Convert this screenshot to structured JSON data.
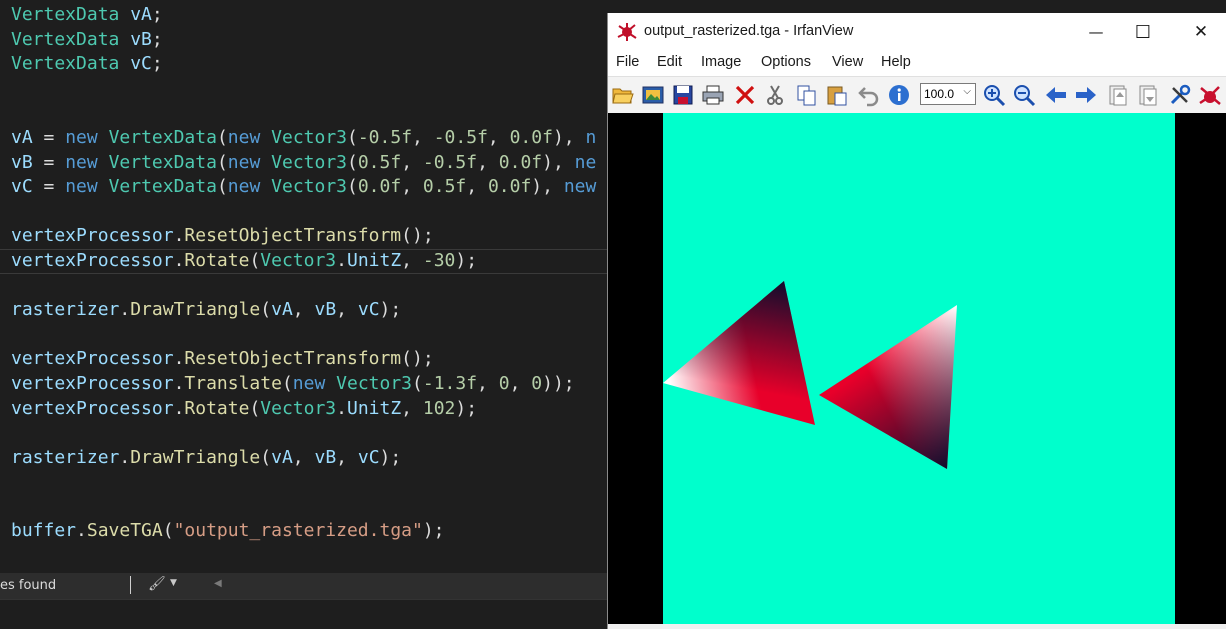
{
  "editor": {
    "lines": [
      [
        {
          "c": "t-type",
          "t": "VertexData"
        },
        {
          "c": "t-var",
          "t": " vA"
        },
        {
          "c": "t-pun",
          "t": ";"
        }
      ],
      [
        {
          "c": "t-type",
          "t": "VertexData"
        },
        {
          "c": "t-var",
          "t": " vB"
        },
        {
          "c": "t-pun",
          "t": ";"
        }
      ],
      [
        {
          "c": "t-type",
          "t": "VertexData"
        },
        {
          "c": "t-var",
          "t": " vC"
        },
        {
          "c": "t-pun",
          "t": ";"
        }
      ],
      [],
      [],
      [
        {
          "c": "t-var",
          "t": "vA"
        },
        {
          "c": "t-pun",
          "t": " = "
        },
        {
          "c": "t-kw",
          "t": "new"
        },
        {
          "c": "t-pun",
          "t": " "
        },
        {
          "c": "t-type",
          "t": "VertexData"
        },
        {
          "c": "t-pun",
          "t": "("
        },
        {
          "c": "t-kw",
          "t": "new"
        },
        {
          "c": "t-pun",
          "t": " "
        },
        {
          "c": "t-type",
          "t": "Vector3"
        },
        {
          "c": "t-pun",
          "t": "("
        },
        {
          "c": "t-num",
          "t": "-0.5f"
        },
        {
          "c": "t-pun",
          "t": ", "
        },
        {
          "c": "t-num",
          "t": "-0.5f"
        },
        {
          "c": "t-pun",
          "t": ", "
        },
        {
          "c": "t-num",
          "t": "0.0f"
        },
        {
          "c": "t-pun",
          "t": "), "
        },
        {
          "c": "t-kw",
          "t": "n"
        }
      ],
      [
        {
          "c": "t-var",
          "t": "vB"
        },
        {
          "c": "t-pun",
          "t": " = "
        },
        {
          "c": "t-kw",
          "t": "new"
        },
        {
          "c": "t-pun",
          "t": " "
        },
        {
          "c": "t-type",
          "t": "VertexData"
        },
        {
          "c": "t-pun",
          "t": "("
        },
        {
          "c": "t-kw",
          "t": "new"
        },
        {
          "c": "t-pun",
          "t": " "
        },
        {
          "c": "t-type",
          "t": "Vector3"
        },
        {
          "c": "t-pun",
          "t": "("
        },
        {
          "c": "t-num",
          "t": "0.5f"
        },
        {
          "c": "t-pun",
          "t": ", "
        },
        {
          "c": "t-num",
          "t": "-0.5f"
        },
        {
          "c": "t-pun",
          "t": ", "
        },
        {
          "c": "t-num",
          "t": "0.0f"
        },
        {
          "c": "t-pun",
          "t": "), "
        },
        {
          "c": "t-kw",
          "t": "ne"
        }
      ],
      [
        {
          "c": "t-var",
          "t": "vC"
        },
        {
          "c": "t-pun",
          "t": " = "
        },
        {
          "c": "t-kw",
          "t": "new"
        },
        {
          "c": "t-pun",
          "t": " "
        },
        {
          "c": "t-type",
          "t": "VertexData"
        },
        {
          "c": "t-pun",
          "t": "("
        },
        {
          "c": "t-kw",
          "t": "new"
        },
        {
          "c": "t-pun",
          "t": " "
        },
        {
          "c": "t-type",
          "t": "Vector3"
        },
        {
          "c": "t-pun",
          "t": "("
        },
        {
          "c": "t-num",
          "t": "0.0f"
        },
        {
          "c": "t-pun",
          "t": ", "
        },
        {
          "c": "t-num",
          "t": "0.5f"
        },
        {
          "c": "t-pun",
          "t": ", "
        },
        {
          "c": "t-num",
          "t": "0.0f"
        },
        {
          "c": "t-pun",
          "t": "), "
        },
        {
          "c": "t-kw",
          "t": "new"
        }
      ],
      [],
      [
        {
          "c": "t-var",
          "t": "vertexProcessor"
        },
        {
          "c": "t-pun",
          "t": "."
        },
        {
          "c": "t-fn",
          "t": "ResetObjectTransform"
        },
        {
          "c": "t-pun",
          "t": "();"
        }
      ],
      [
        {
          "c": "t-var",
          "t": "vertexProcessor"
        },
        {
          "c": "t-pun",
          "t": "."
        },
        {
          "c": "t-fn",
          "t": "Rotate"
        },
        {
          "c": "t-pun",
          "t": "("
        },
        {
          "c": "t-type",
          "t": "Vector3"
        },
        {
          "c": "t-pun",
          "t": "."
        },
        {
          "c": "t-var",
          "t": "UnitZ"
        },
        {
          "c": "t-pun",
          "t": ", "
        },
        {
          "c": "t-num",
          "t": "-30"
        },
        {
          "c": "t-pun",
          "t": ");"
        }
      ],
      [],
      [
        {
          "c": "t-var",
          "t": "rasterizer"
        },
        {
          "c": "t-pun",
          "t": "."
        },
        {
          "c": "t-fn",
          "t": "DrawTriangle"
        },
        {
          "c": "t-pun",
          "t": "("
        },
        {
          "c": "t-var",
          "t": "vA"
        },
        {
          "c": "t-pun",
          "t": ", "
        },
        {
          "c": "t-var",
          "t": "vB"
        },
        {
          "c": "t-pun",
          "t": ", "
        },
        {
          "c": "t-var",
          "t": "vC"
        },
        {
          "c": "t-pun",
          "t": ");"
        }
      ],
      [],
      [
        {
          "c": "t-var",
          "t": "vertexProcessor"
        },
        {
          "c": "t-pun",
          "t": "."
        },
        {
          "c": "t-fn",
          "t": "ResetObjectTransform"
        },
        {
          "c": "t-pun",
          "t": "();"
        }
      ],
      [
        {
          "c": "t-var",
          "t": "vertexProcessor"
        },
        {
          "c": "t-pun",
          "t": "."
        },
        {
          "c": "t-fn",
          "t": "Translate"
        },
        {
          "c": "t-pun",
          "t": "("
        },
        {
          "c": "t-kw",
          "t": "new"
        },
        {
          "c": "t-pun",
          "t": " "
        },
        {
          "c": "t-type",
          "t": "Vector3"
        },
        {
          "c": "t-pun",
          "t": "("
        },
        {
          "c": "t-num",
          "t": "-1.3f"
        },
        {
          "c": "t-pun",
          "t": ", "
        },
        {
          "c": "t-num",
          "t": "0"
        },
        {
          "c": "t-pun",
          "t": ", "
        },
        {
          "c": "t-num",
          "t": "0"
        },
        {
          "c": "t-pun",
          "t": "));"
        }
      ],
      [
        {
          "c": "t-var",
          "t": "vertexProcessor"
        },
        {
          "c": "t-pun",
          "t": "."
        },
        {
          "c": "t-fn",
          "t": "Rotate"
        },
        {
          "c": "t-pun",
          "t": "("
        },
        {
          "c": "t-type",
          "t": "Vector3"
        },
        {
          "c": "t-pun",
          "t": "."
        },
        {
          "c": "t-var",
          "t": "UnitZ"
        },
        {
          "c": "t-pun",
          "t": ", "
        },
        {
          "c": "t-num",
          "t": "102"
        },
        {
          "c": "t-pun",
          "t": ");"
        }
      ],
      [],
      [
        {
          "c": "t-var",
          "t": "rasterizer"
        },
        {
          "c": "t-pun",
          "t": "."
        },
        {
          "c": "t-fn",
          "t": "DrawTriangle"
        },
        {
          "c": "t-pun",
          "t": "("
        },
        {
          "c": "t-var",
          "t": "vA"
        },
        {
          "c": "t-pun",
          "t": ", "
        },
        {
          "c": "t-var",
          "t": "vB"
        },
        {
          "c": "t-pun",
          "t": ", "
        },
        {
          "c": "t-var",
          "t": "vC"
        },
        {
          "c": "t-pun",
          "t": ");"
        }
      ],
      [],
      [],
      [
        {
          "c": "t-var",
          "t": "buffer"
        },
        {
          "c": "t-pun",
          "t": "."
        },
        {
          "c": "t-fn",
          "t": "SaveTGA"
        },
        {
          "c": "t-pun",
          "t": "("
        },
        {
          "c": "t-str",
          "t": "\"output_rasterized.tga\""
        },
        {
          "c": "t-pun",
          "t": ");"
        }
      ]
    ],
    "highlighted_line": 10,
    "statusbar": {
      "issues_text": "es found",
      "brush_icon": "paintbrush-icon",
      "dropdown_icon": "chevron-down-icon",
      "scroll_icon": "scroll-left-arrow-icon"
    }
  },
  "viewer": {
    "title": "output_rasterized.tga - IrfanView",
    "window_buttons": {
      "minimize": "—",
      "maximize": "☐",
      "close": "✕"
    },
    "menu": [
      "File",
      "Edit",
      "Image",
      "Options",
      "View",
      "Help"
    ],
    "toolbar": {
      "zoom_value": "100.0",
      "icons": [
        "open-folder-icon",
        "slideshow-icon",
        "save-icon",
        "print-icon",
        "delete-icon",
        "cut-icon",
        "copy-icon",
        "paste-icon",
        "undo-icon",
        "info-icon",
        "zoom-in-icon",
        "zoom-out-icon",
        "previous-icon",
        "next-icon",
        "page-up-icon",
        "page-down-icon",
        "settings-icon",
        "irfanview-logo-icon"
      ]
    },
    "image": {
      "background_color": "#00ffcc",
      "border_color": "#000000",
      "triangle_colors": {
        "white": "#ffffff",
        "red": "#e8002a",
        "dark": "#1a1030"
      }
    }
  }
}
